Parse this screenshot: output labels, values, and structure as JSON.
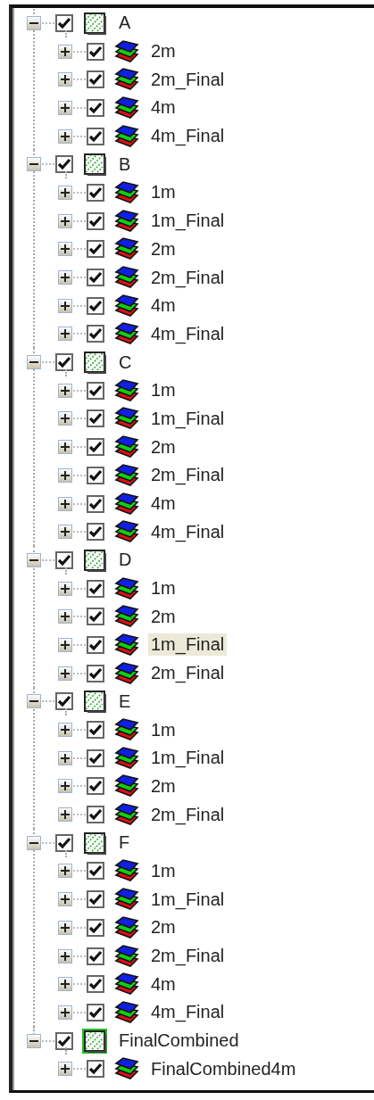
{
  "tree": [
    {
      "label": "A",
      "expanded": true,
      "checked": true,
      "highlighted": false,
      "children": [
        {
          "label": "2m",
          "expanded": false,
          "checked": true,
          "selected": false
        },
        {
          "label": "2m_Final",
          "expanded": false,
          "checked": true,
          "selected": false
        },
        {
          "label": "4m",
          "expanded": false,
          "checked": true,
          "selected": false
        },
        {
          "label": "4m_Final",
          "expanded": false,
          "checked": true,
          "selected": false
        }
      ]
    },
    {
      "label": "B",
      "expanded": true,
      "checked": true,
      "highlighted": false,
      "children": [
        {
          "label": "1m",
          "expanded": false,
          "checked": true,
          "selected": false
        },
        {
          "label": "1m_Final",
          "expanded": false,
          "checked": true,
          "selected": false
        },
        {
          "label": "2m",
          "expanded": false,
          "checked": true,
          "selected": false
        },
        {
          "label": "2m_Final",
          "expanded": false,
          "checked": true,
          "selected": false
        },
        {
          "label": "4m",
          "expanded": false,
          "checked": true,
          "selected": false
        },
        {
          "label": "4m_Final",
          "expanded": false,
          "checked": true,
          "selected": false
        }
      ]
    },
    {
      "label": "C",
      "expanded": true,
      "checked": true,
      "highlighted": false,
      "children": [
        {
          "label": "1m",
          "expanded": false,
          "checked": true,
          "selected": false
        },
        {
          "label": "1m_Final",
          "expanded": false,
          "checked": true,
          "selected": false
        },
        {
          "label": "2m",
          "expanded": false,
          "checked": true,
          "selected": false
        },
        {
          "label": "2m_Final",
          "expanded": false,
          "checked": true,
          "selected": false
        },
        {
          "label": "4m",
          "expanded": false,
          "checked": true,
          "selected": false
        },
        {
          "label": "4m_Final",
          "expanded": false,
          "checked": true,
          "selected": false
        }
      ]
    },
    {
      "label": "D",
      "expanded": true,
      "checked": true,
      "highlighted": false,
      "children": [
        {
          "label": "1m",
          "expanded": false,
          "checked": true,
          "selected": false
        },
        {
          "label": "2m",
          "expanded": false,
          "checked": true,
          "selected": false
        },
        {
          "label": "1m_Final",
          "expanded": false,
          "checked": true,
          "selected": true
        },
        {
          "label": "2m_Final",
          "expanded": false,
          "checked": true,
          "selected": false
        }
      ]
    },
    {
      "label": "E",
      "expanded": true,
      "checked": true,
      "highlighted": false,
      "children": [
        {
          "label": "1m",
          "expanded": false,
          "checked": true,
          "selected": false
        },
        {
          "label": "1m_Final",
          "expanded": false,
          "checked": true,
          "selected": false
        },
        {
          "label": "2m",
          "expanded": false,
          "checked": true,
          "selected": false
        },
        {
          "label": "2m_Final",
          "expanded": false,
          "checked": true,
          "selected": false
        }
      ]
    },
    {
      "label": "F",
      "expanded": true,
      "checked": true,
      "highlighted": false,
      "children": [
        {
          "label": "1m",
          "expanded": false,
          "checked": true,
          "selected": false
        },
        {
          "label": "1m_Final",
          "expanded": false,
          "checked": true,
          "selected": false
        },
        {
          "label": "2m",
          "expanded": false,
          "checked": true,
          "selected": false
        },
        {
          "label": "2m_Final",
          "expanded": false,
          "checked": true,
          "selected": false
        },
        {
          "label": "4m",
          "expanded": false,
          "checked": true,
          "selected": false
        },
        {
          "label": "4m_Final",
          "expanded": false,
          "checked": true,
          "selected": false
        }
      ]
    },
    {
      "label": "FinalCombined",
      "expanded": true,
      "checked": true,
      "highlighted": true,
      "children": [
        {
          "label": "FinalCombined4m",
          "expanded": false,
          "checked": true,
          "selected": false
        }
      ]
    }
  ]
}
